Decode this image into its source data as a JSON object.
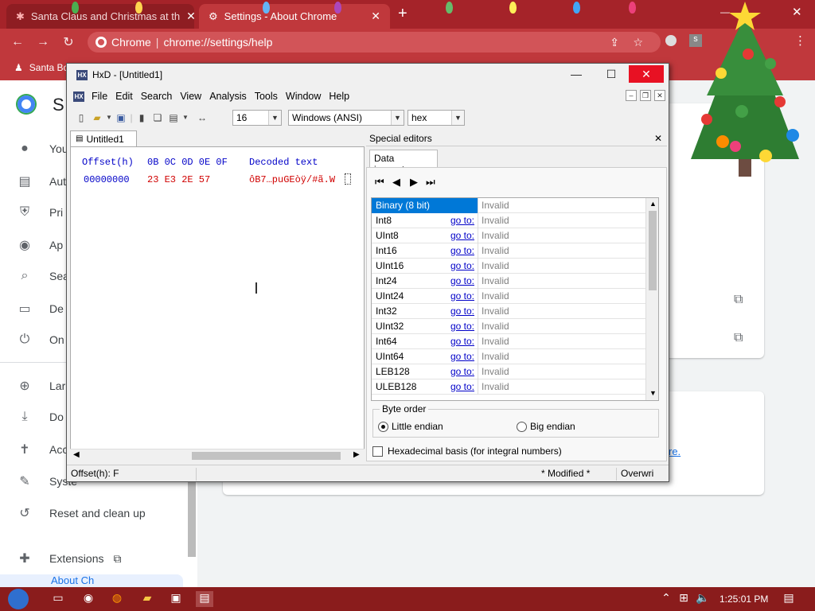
{
  "chrome": {
    "tabs": [
      {
        "label": "Santa Claus and Christmas at th",
        "active": false
      },
      {
        "label": "Settings - About Chrome",
        "active": true
      }
    ],
    "new_tab": "+",
    "omnibox": {
      "site": "Chrome",
      "separator": "|",
      "url": "chrome://settings/help"
    },
    "bookmark": "Santa Bo",
    "profile_initial": "s"
  },
  "settings": {
    "title_initial": "S",
    "menu": [
      {
        "label": "You",
        "icon": "person-icon"
      },
      {
        "label": "Aut",
        "icon": "clipboard-icon"
      },
      {
        "label": "Pri",
        "icon": "shield-icon"
      },
      {
        "label": "Ap",
        "icon": "palette-icon"
      },
      {
        "label": "Sea",
        "icon": "search-icon"
      },
      {
        "label": "De",
        "icon": "browser-icon"
      },
      {
        "label": "On",
        "icon": "power-icon"
      },
      {
        "label": "Lar",
        "icon": "globe-icon"
      },
      {
        "label": "Do",
        "icon": "download-icon"
      },
      {
        "label": "Acc",
        "icon": "accessibility-icon"
      },
      {
        "label": "Syste",
        "icon": "wrench-icon"
      },
      {
        "label": "Reset and clean up",
        "icon": "reset-icon"
      },
      {
        "label": "Extensions",
        "icon": "puzzle-icon"
      },
      {
        "label": "About Ch",
        "icon": "chrome-icon"
      }
    ],
    "link_fragment": "re."
  },
  "hxd": {
    "title": "HxD - [Untitled1]",
    "menus": [
      "File",
      "Edit",
      "Search",
      "View",
      "Analysis",
      "Tools",
      "Window",
      "Help"
    ],
    "bytes_per_row": "16",
    "charset": "Windows (ANSI)",
    "display": "hex",
    "doc_tab": "Untitled1",
    "hex_header": {
      "offset": "Offset(h)",
      "columns": "0B 0C 0D 0E 0F",
      "decoded": "Decoded text"
    },
    "hex_rows": [
      {
        "offset": "00000000",
        "bytes": "23 E3 2E 57",
        "decoded": "ôB7…puGEòÿ/#ã.W"
      }
    ],
    "special_editors": "Special editors",
    "data_inspector": {
      "tab": "Data inspector",
      "rows": [
        {
          "type": "Binary (8 bit)",
          "goto": "",
          "value": "Invalid",
          "selected": true
        },
        {
          "type": "Int8",
          "goto": "go to:",
          "value": "Invalid"
        },
        {
          "type": "UInt8",
          "goto": "go to:",
          "value": "Invalid"
        },
        {
          "type": "Int16",
          "goto": "go to:",
          "value": "Invalid"
        },
        {
          "type": "UInt16",
          "goto": "go to:",
          "value": "Invalid"
        },
        {
          "type": "Int24",
          "goto": "go to:",
          "value": "Invalid"
        },
        {
          "type": "UInt24",
          "goto": "go to:",
          "value": "Invalid"
        },
        {
          "type": "Int32",
          "goto": "go to:",
          "value": "Invalid"
        },
        {
          "type": "UInt32",
          "goto": "go to:",
          "value": "Invalid"
        },
        {
          "type": "Int64",
          "goto": "go to:",
          "value": "Invalid"
        },
        {
          "type": "UInt64",
          "goto": "go to:",
          "value": "Invalid"
        },
        {
          "type": "LEB128",
          "goto": "go to:",
          "value": "Invalid"
        },
        {
          "type": "ULEB128",
          "goto": "go to:",
          "value": "Invalid"
        }
      ],
      "byte_order": {
        "label": "Byte order",
        "little": "Little endian",
        "big": "Big endian",
        "selected": "little"
      },
      "hex_basis": "Hexadecimal basis (for integral numbers)"
    },
    "status": {
      "offset": "Offset(h): F",
      "modified": "* Modified *",
      "mode": "Overwri"
    }
  },
  "taskbar": {
    "clock": "1:25:01 PM"
  },
  "colors": {
    "chrome_dark": "#a52329",
    "chrome": "#c0383c",
    "accent": "#0078d7",
    "hex_red": "#d00000",
    "hex_blue": "#0000c8"
  }
}
